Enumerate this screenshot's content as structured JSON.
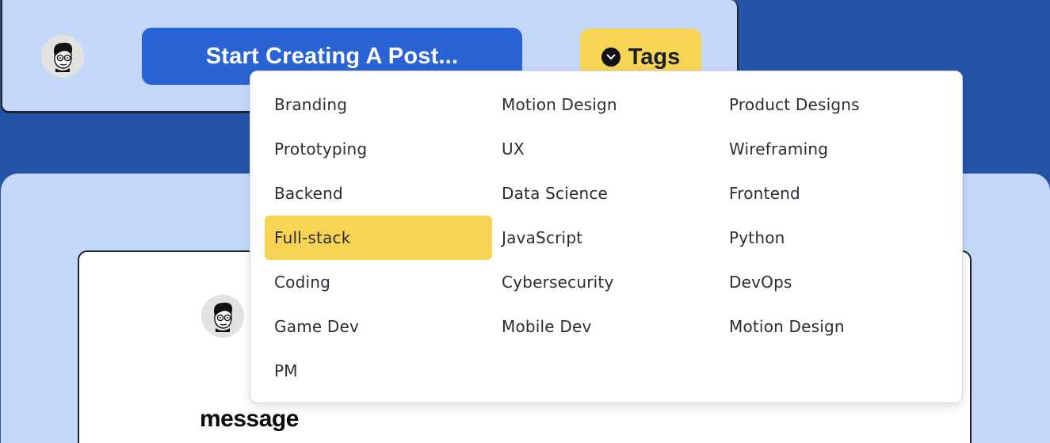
{
  "composer": {
    "start_label": "Start Creating A Post...",
    "tags_label": "Tags",
    "tags_icon": "chevron-down-circle-icon"
  },
  "colors": {
    "background": "#2454a8",
    "card": "#c4d9fa",
    "primary_button": "#2a63d4",
    "accent": "#f7d454"
  },
  "tags_dropdown": {
    "selected": "Full-stack",
    "items": [
      "Branding",
      "Motion Design",
      "Product Designs",
      "Prototyping",
      "UX",
      "Wireframing",
      "Backend",
      "Data Science",
      "Frontend",
      "Full-stack",
      "JavaScript",
      "Python",
      "Coding",
      "Cybersecurity",
      "DevOps",
      "Game Dev",
      "Mobile Dev",
      "Motion Design",
      "PM"
    ]
  },
  "post": {
    "message_title": "message"
  }
}
